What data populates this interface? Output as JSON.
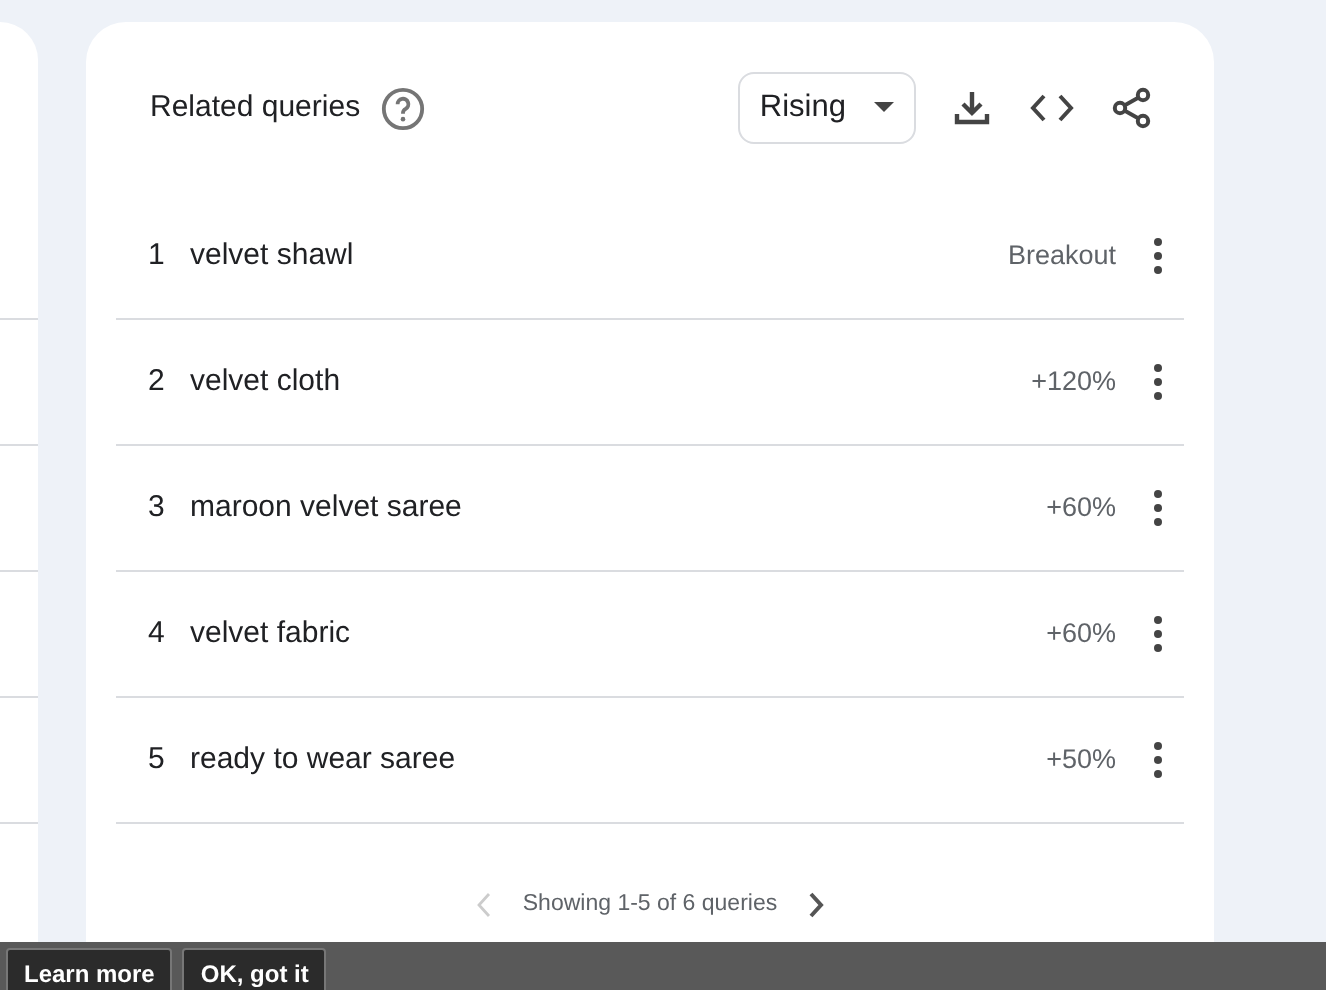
{
  "card": {
    "title": "Related queries",
    "filter": "Rising"
  },
  "queries": [
    {
      "rank": "1",
      "query": "velvet shawl",
      "value": "Breakout"
    },
    {
      "rank": "2",
      "query": "velvet cloth",
      "value": "+120%"
    },
    {
      "rank": "3",
      "query": "maroon velvet saree",
      "value": "+60%"
    },
    {
      "rank": "4",
      "query": "velvet fabric",
      "value": "+60%"
    },
    {
      "rank": "5",
      "query": "ready to wear saree",
      "value": "+50%"
    }
  ],
  "pagination": {
    "text": "Showing 1-5 of 6 queries",
    "prev_disabled": true,
    "next_disabled": false
  },
  "cookie_bar": {
    "buttons": [
      "Learn more",
      "OK, got it"
    ]
  }
}
